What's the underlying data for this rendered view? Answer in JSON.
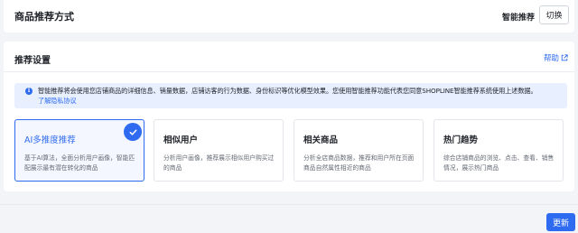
{
  "header": {
    "title": "商品推荐方式",
    "current_mode": "智能推荐",
    "switch_label": "切换"
  },
  "settings": {
    "title": "推荐设置",
    "help_label": "帮助",
    "info_text": "智能推荐将会使用您店铺商品的详细信息、销量数据，店铺访客的行为数据、身份标识等优化模型效果。您使用智能推荐功能代表您同意SHOPLINE智能推荐系统使用上述数据。",
    "privacy_link": "了解隐私协议",
    "options": [
      {
        "title": "AI多推度推荐",
        "desc": "基于AI算法，全面分析用户画像，智能匹配展示最有潜在转化的商品",
        "selected": true
      },
      {
        "title": "相似用户",
        "desc": "分析用户画像，推荐展示相似用户购买过的商品",
        "selected": false
      },
      {
        "title": "相关商品",
        "desc": "分析全店商品数据，推荐和用户所在页面商品自然属性相近的商品",
        "selected": false
      },
      {
        "title": "热门趋势",
        "desc": "综合店铺商品的浏览、点击、查看、销售情况，展示热门商品",
        "selected": false
      }
    ]
  },
  "footer": {
    "update_label": "更新"
  },
  "colors": {
    "accent": "#2f6bf0",
    "info_bg": "#e8f0ff",
    "page_bg": "#f2f4f7"
  },
  "icons": {
    "help": "external-link-icon",
    "info": "info-circle-icon",
    "selected": "check-icon"
  }
}
